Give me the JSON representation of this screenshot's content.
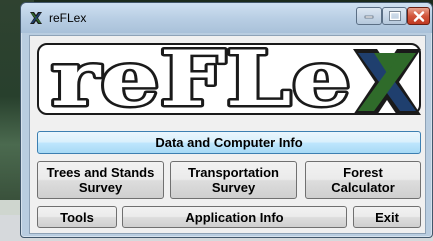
{
  "window": {
    "title": "reFLex",
    "controls": {
      "minimize": "minimize",
      "maximize": "maximize",
      "close": "close"
    }
  },
  "logo": {
    "text_main": "reFLe",
    "text_x": "X",
    "colors": {
      "letters": "#ffffff",
      "outline": "#1a1a1a",
      "x_green": "#2f6b2a",
      "x_blue": "#1f3f6e"
    }
  },
  "buttons": {
    "data_info": "Data and Computer Info",
    "trees_line1": "Trees and Stands",
    "trees_line2": "Survey",
    "transport_line1": "Transportation",
    "transport_line2": "Survey",
    "forest_line1": "Forest",
    "forest_line2": "Calculator",
    "tools": "Tools",
    "app_info": "Application Info",
    "exit": "Exit"
  }
}
